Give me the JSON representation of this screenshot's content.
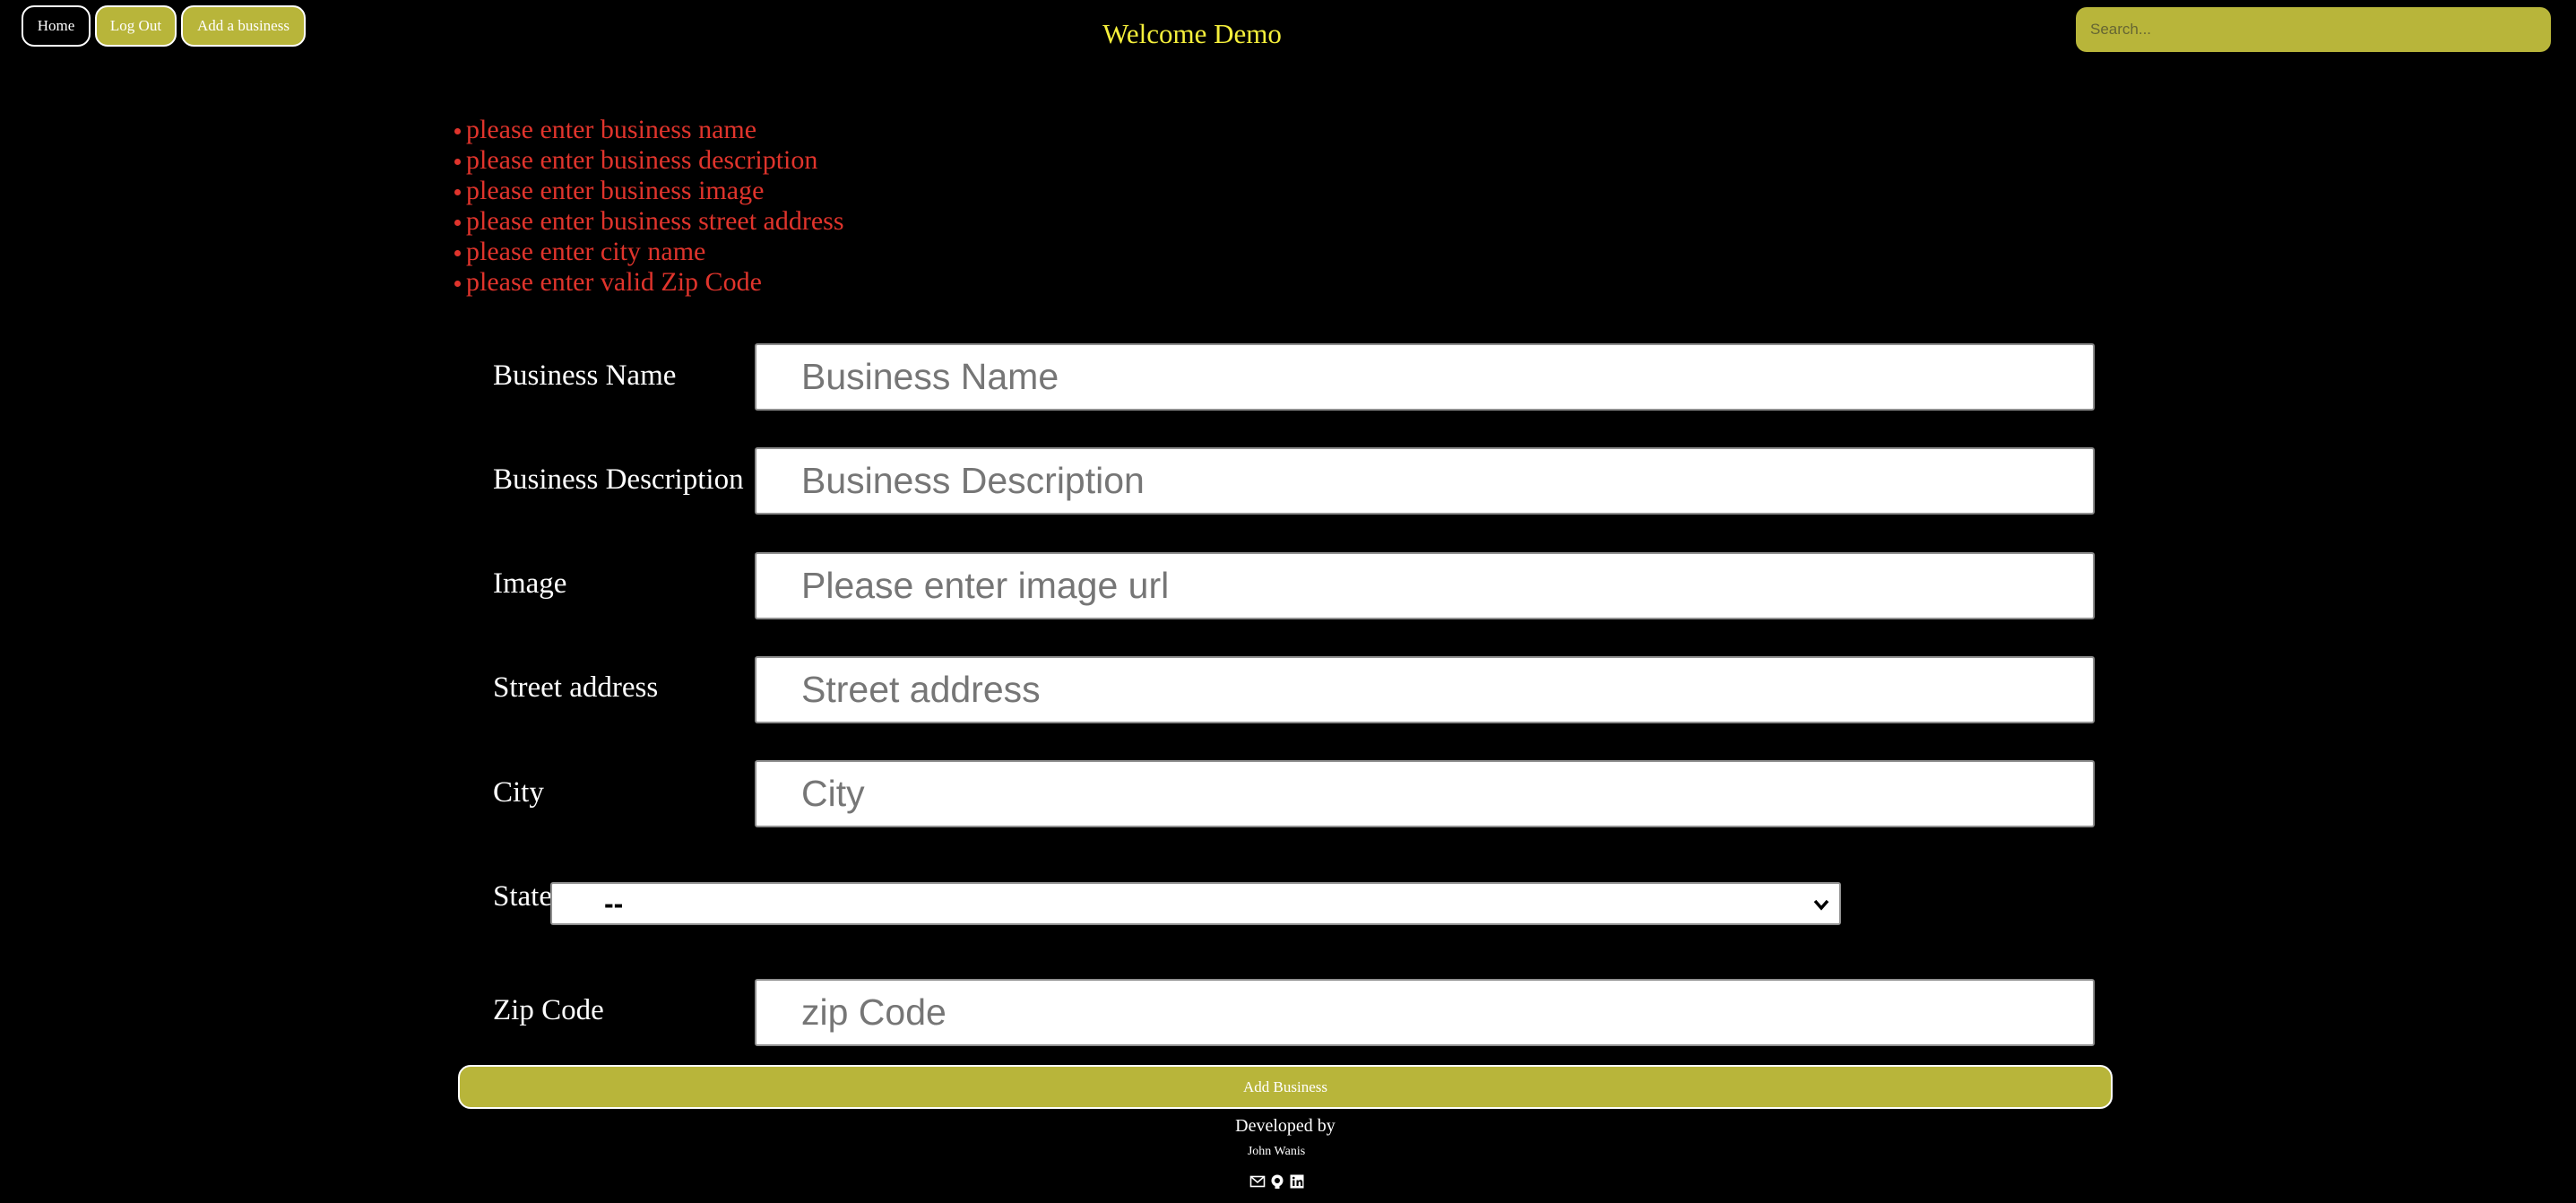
{
  "nav": {
    "home": "Home",
    "logout": "Log Out",
    "add_business": "Add a business",
    "welcome": "Welcome Demo",
    "search_placeholder": "Search..."
  },
  "errors": [
    "please enter business name",
    "please enter business description",
    "please enter business image",
    "please enter business street address",
    "please enter city name",
    "please enter valid Zip Code"
  ],
  "form": {
    "business_name": {
      "label": "Business Name",
      "placeholder": "Business Name",
      "value": ""
    },
    "business_description": {
      "label": "Business Description",
      "placeholder": "Business Description",
      "value": ""
    },
    "image": {
      "label": "Image",
      "placeholder": "Please enter image url",
      "value": ""
    },
    "street_address": {
      "label": "Street address",
      "placeholder": "Street address",
      "value": ""
    },
    "city": {
      "label": "City",
      "placeholder": "City",
      "value": ""
    },
    "state": {
      "label": "State",
      "selected": "--"
    },
    "zip": {
      "label": "Zip Code",
      "placeholder": "zip Code",
      "value": ""
    },
    "submit_label": "Add Business"
  },
  "footer": {
    "developed_by": "Developed by",
    "name": "John Wanis",
    "icons": [
      "envelope-icon",
      "github-icon",
      "linkedin-icon"
    ]
  },
  "colors": {
    "accent": "#b8b53a",
    "welcome": "#f5ef3b",
    "error": "#e0342c",
    "background": "#000000"
  }
}
